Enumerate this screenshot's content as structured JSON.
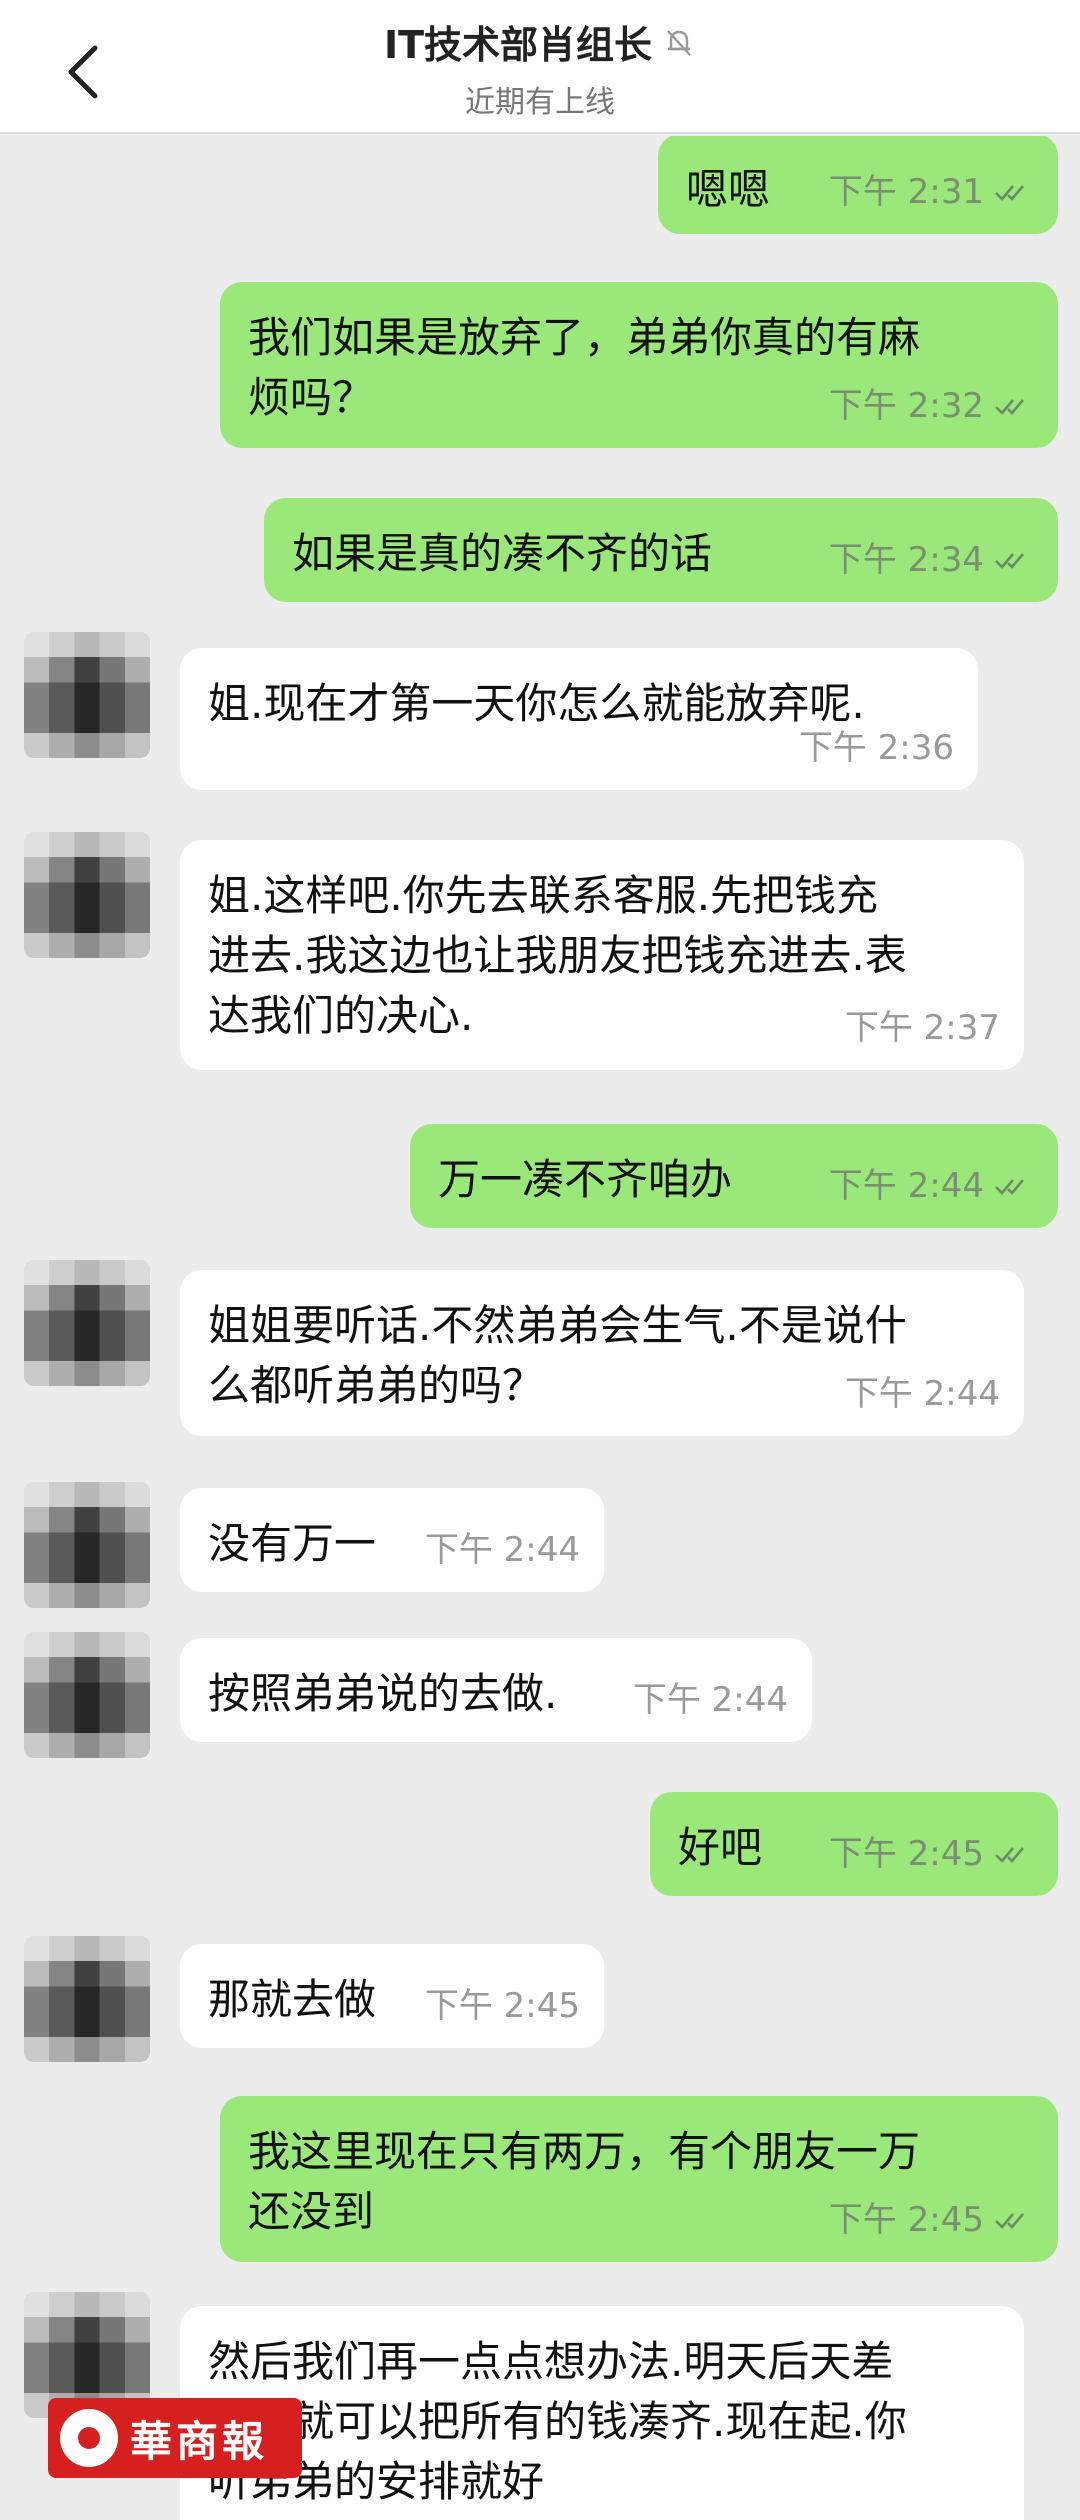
{
  "header": {
    "title": "IT技术部肖组长",
    "subtitle": "近期有上线",
    "icons": {
      "back": "chevron-left-icon",
      "muted": "bell-off-icon"
    }
  },
  "messages": [
    {
      "side": "out",
      "text": "嗯嗯",
      "time": "下午 2:31",
      "read": true
    },
    {
      "side": "out",
      "text": "我们如果是放弃了，弟弟你真的有麻\n烦吗？",
      "time": "下午 2:32",
      "read": true
    },
    {
      "side": "out",
      "text": "如果是真的凑不齐的话",
      "time": "下午 2:34",
      "read": true
    },
    {
      "side": "in",
      "text": "姐.现在才第一天你怎么就能放弃呢.",
      "time": "下午 2:36"
    },
    {
      "side": "in",
      "text": "姐.这样吧.你先去联系客服.先把钱充\n进去.我这边也让我朋友把钱充进去.表\n达我们的决心.",
      "time": "下午 2:37"
    },
    {
      "side": "out",
      "text": "万一凑不齐咱办",
      "time": "下午 2:44",
      "read": true
    },
    {
      "side": "in",
      "text": "姐姐要听话.不然弟弟会生气.不是说什\n么都听弟弟的吗？",
      "time": "下午 2:44"
    },
    {
      "side": "in",
      "text": "没有万一",
      "time": "下午 2:44"
    },
    {
      "side": "in",
      "text": "按照弟弟说的去做.",
      "time": "下午 2:44"
    },
    {
      "side": "out",
      "text": "好吧",
      "time": "下午 2:45",
      "read": true
    },
    {
      "side": "in",
      "text": "那就去做",
      "time": "下午 2:45"
    },
    {
      "side": "out",
      "text": "我这里现在只有两万，有个朋友一万\n还没到",
      "time": "下午 2:45",
      "read": true
    },
    {
      "side": "in",
      "text": "然后我们再一点点想办法.明天后天差\n不多就可以把所有的钱凑齐.现在起.你\n听弟弟的安排就好",
      "time": ""
    }
  ],
  "watermark": {
    "text": "華商報"
  },
  "colors": {
    "outgoing_bubble": "#9be87a",
    "incoming_bubble": "#ffffff",
    "background": "#ececec"
  }
}
